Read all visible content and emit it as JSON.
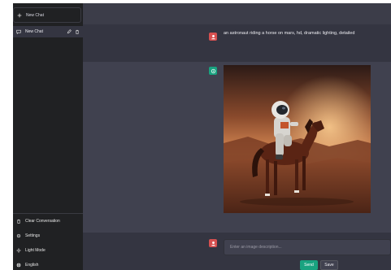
{
  "sidebar": {
    "new_chat_label": "New Chat",
    "chat_items": [
      {
        "label": "New Chat"
      }
    ],
    "bottom": {
      "clear_label": "Clear Conversation",
      "settings_label": "Settings",
      "light_mode_label": "Light Mode",
      "language_label": "English"
    }
  },
  "conversation": {
    "user_prompt": "an astronaut riding a horse on mars, hd, dramatic lighting, detailed"
  },
  "composer": {
    "placeholder": "Enter an image description...",
    "send_label": "Send",
    "save_label": "Save"
  },
  "colors": {
    "sidebar_bg": "#202123",
    "main_bg": "#343541",
    "assistant_row_bg": "#40414f",
    "user_avatar": "#d65050",
    "assistant_avatar": "#19a380",
    "send_button": "#19a380"
  }
}
